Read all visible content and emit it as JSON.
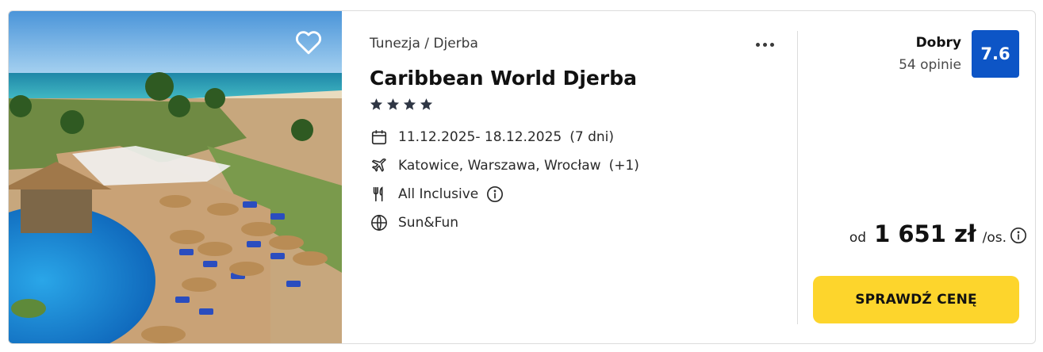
{
  "offer": {
    "location": "Tunezja / Djerba",
    "hotel_name": "Caribbean World Djerba",
    "stars": 4,
    "dates": "11.12.2025- 18.12.2025",
    "duration": "(7 dni)",
    "departures": "Katowice, Warszawa, Wrocław",
    "departures_extra": "(+1)",
    "board": "All Inclusive",
    "theme": "Sun&Fun"
  },
  "rating": {
    "label": "Dobry",
    "reviews": "54 opinie",
    "score": "7.6"
  },
  "price": {
    "from": "od",
    "amount": "1 651 zł",
    "unit": "/os."
  },
  "cta_label": "SPRAWDŹ CENĘ",
  "icons": {
    "favorite": "heart-icon",
    "menu": "more-dots-icon",
    "dates": "calendar-icon",
    "departures": "airplane-icon",
    "board": "cutlery-icon",
    "info": "info-icon",
    "theme": "globe-icon",
    "rating": "star-icon"
  },
  "colors": {
    "score_badge": "#0d55c6",
    "cta": "#fdd52c",
    "stars": "#2f3644"
  }
}
